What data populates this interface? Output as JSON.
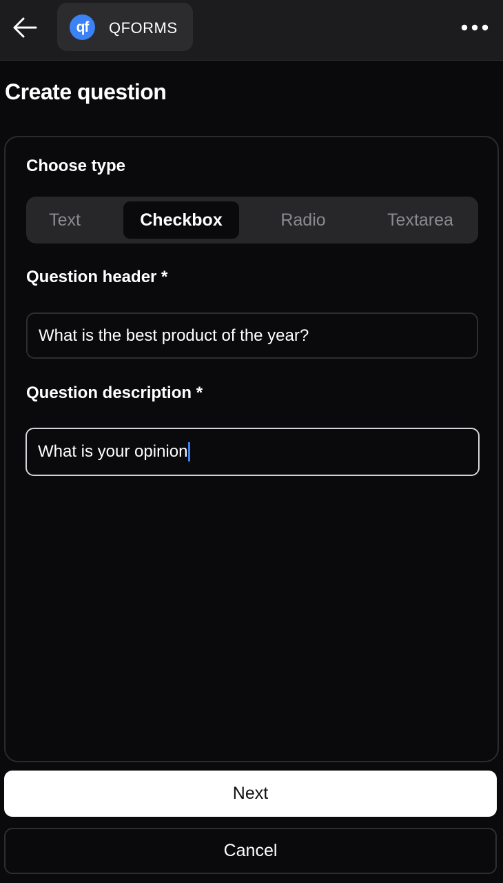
{
  "header": {
    "app_logo_text": "qf",
    "app_name": "QFORMS"
  },
  "page": {
    "title": "Create question"
  },
  "form": {
    "choose_type_label": "Choose type",
    "types": [
      "Text",
      "Checkbox",
      "Radio",
      "Textarea"
    ],
    "selected_type": "Checkbox",
    "header_label": "Question header *",
    "header_value": "What is the best product of the year?",
    "description_label": "Question description *",
    "description_value": "What is your opinion"
  },
  "actions": {
    "next_label": "Next",
    "cancel_label": "Cancel"
  },
  "colors": {
    "accent": "#3b82f6",
    "background": "#0a0a0c"
  }
}
